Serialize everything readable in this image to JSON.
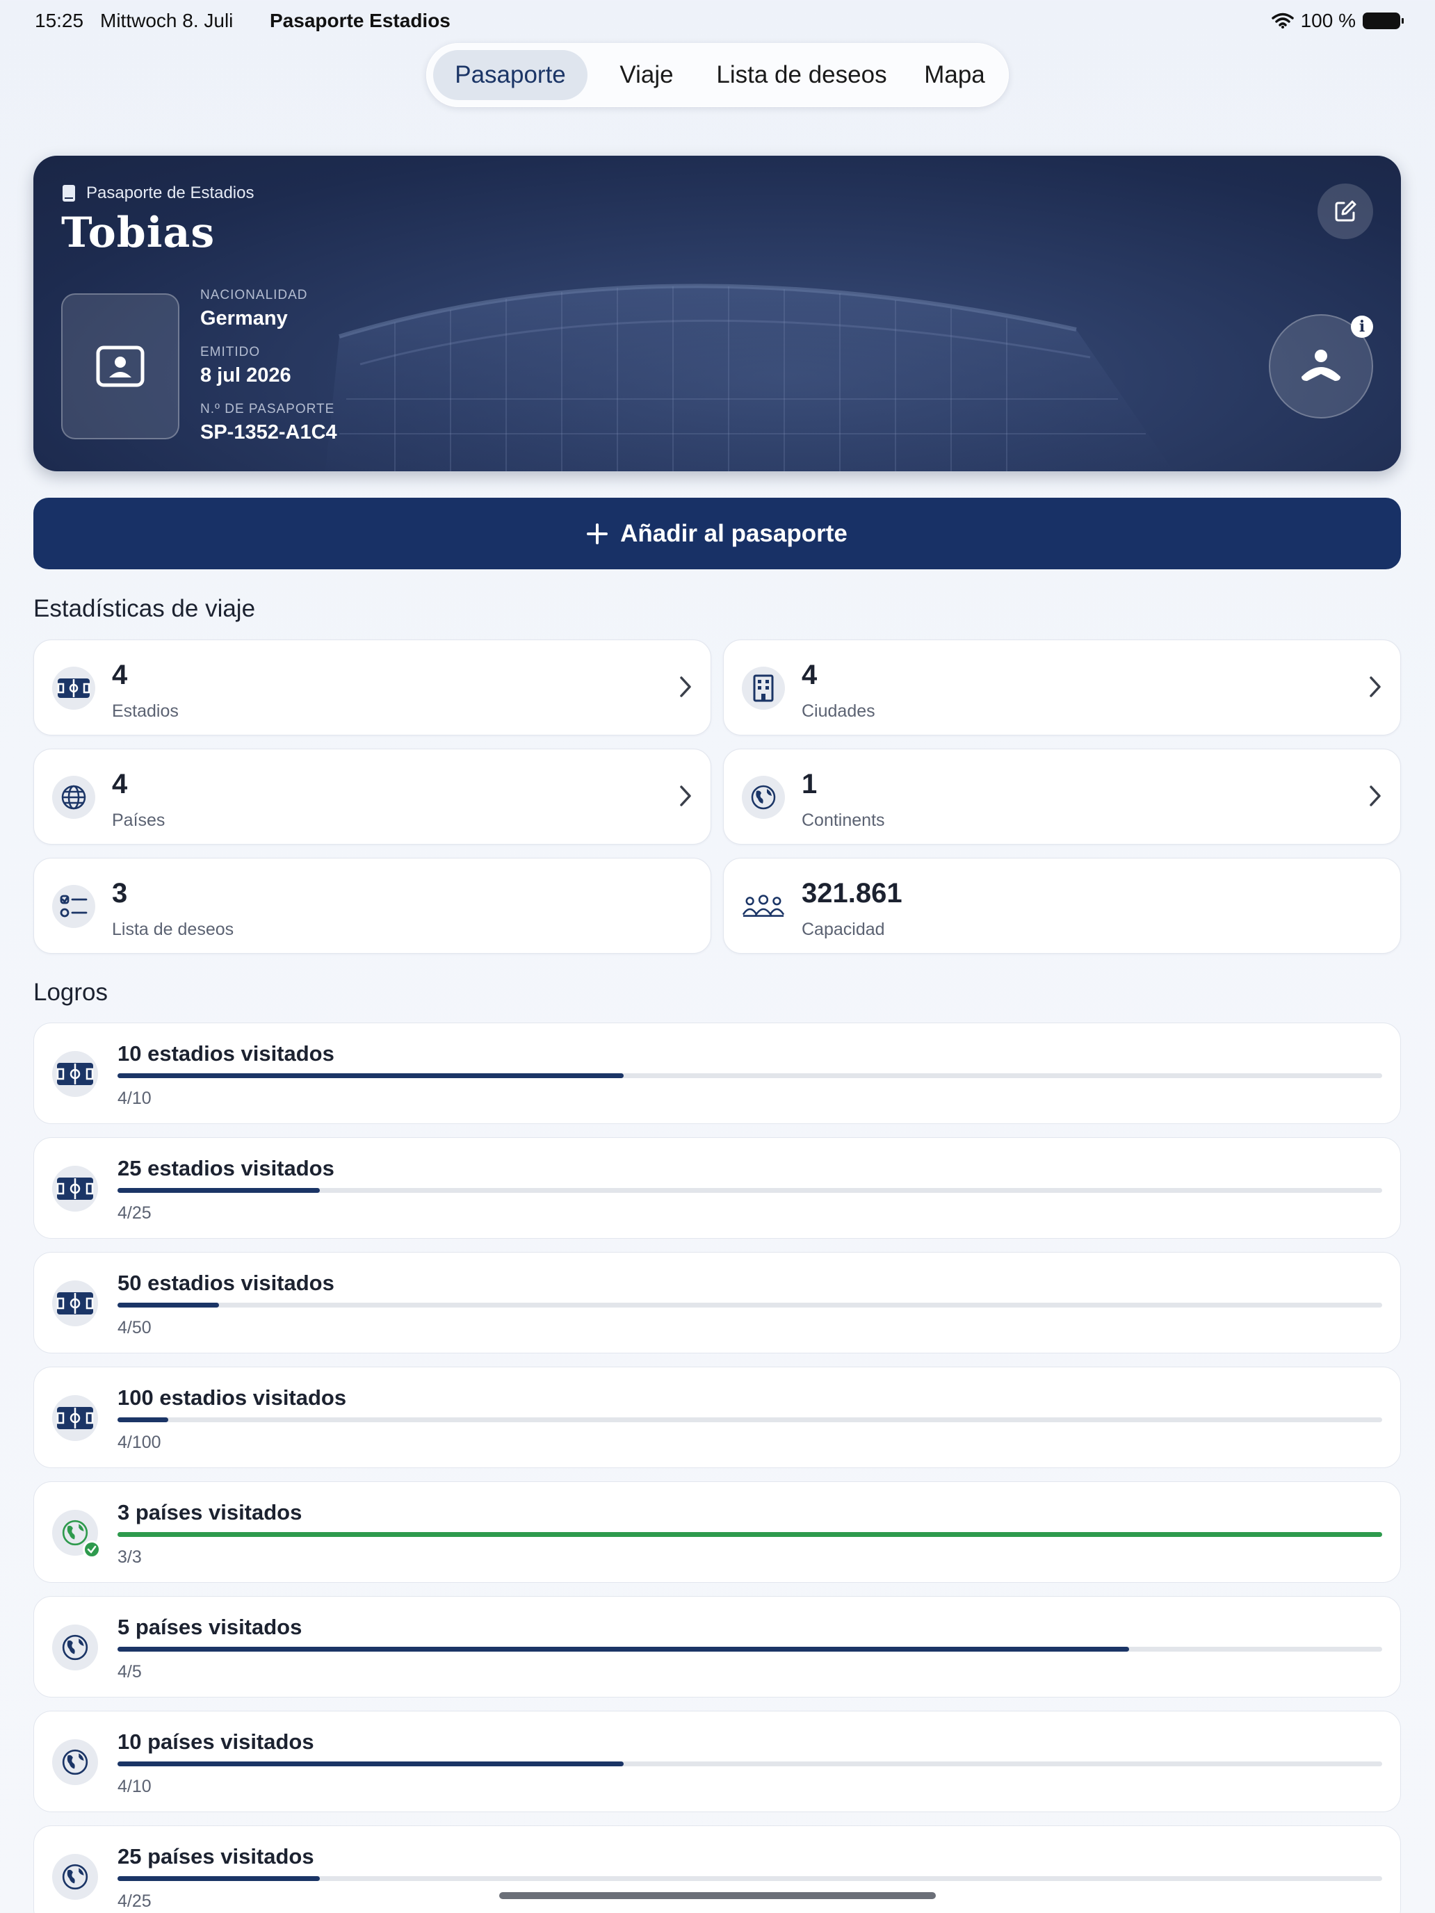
{
  "status_bar": {
    "time": "15:25",
    "date": "Mittwoch 8. Juli",
    "app_name": "Pasaporte Estadios",
    "battery": "100 %"
  },
  "tabs": [
    {
      "label": "Pasaporte",
      "active": true
    },
    {
      "label": "Viaje",
      "active": false
    },
    {
      "label": "Lista de deseos",
      "active": false
    },
    {
      "label": "Mapa",
      "active": false
    }
  ],
  "passport": {
    "label": "Pasaporte de Estadios",
    "name": "Tobias",
    "nationality_label": "NACIONALIDAD",
    "nationality": "Germany",
    "issued_label": "EMITIDO",
    "issued": "8 jul 2026",
    "number_label": "N.º DE PASAPORTE",
    "number": "SP-1352-A1C4",
    "info_icon": "i"
  },
  "add_button": {
    "label": "Añadir al pasaporte"
  },
  "stats": {
    "title": "Estadísticas de viaje",
    "items": [
      {
        "value": "4",
        "label": "Estadios",
        "icon": "stadium-icon",
        "chevron": true
      },
      {
        "value": "4",
        "label": "Ciudades",
        "icon": "building-icon",
        "chevron": true
      },
      {
        "value": "4",
        "label": "Países",
        "icon": "globe-icon",
        "chevron": true
      },
      {
        "value": "1",
        "label": "Continents",
        "icon": "earth-icon",
        "chevron": true
      },
      {
        "value": "3",
        "label": "Lista de deseos",
        "icon": "checklist-icon",
        "chevron": false
      },
      {
        "value": "321.861",
        "label": "Capacidad",
        "icon": "people-icon",
        "chevron": false
      }
    ]
  },
  "achievements": {
    "title": "Logros",
    "items": [
      {
        "title": "10 estadios visitados",
        "progress": "4/10",
        "fraction": 0.4,
        "icon": "stadium-icon",
        "done": false
      },
      {
        "title": "25 estadios visitados",
        "progress": "4/25",
        "fraction": 0.16,
        "icon": "stadium-icon",
        "done": false
      },
      {
        "title": "50 estadios visitados",
        "progress": "4/50",
        "fraction": 0.08,
        "icon": "stadium-icon",
        "done": false
      },
      {
        "title": "100 estadios visitados",
        "progress": "4/100",
        "fraction": 0.04,
        "icon": "stadium-icon",
        "done": false
      },
      {
        "title": "3 países visitados",
        "progress": "3/3",
        "fraction": 1.0,
        "icon": "earth-icon",
        "done": true
      },
      {
        "title": "5 países visitados",
        "progress": "4/5",
        "fraction": 0.8,
        "icon": "earth-icon",
        "done": false
      },
      {
        "title": "10 países visitados",
        "progress": "4/10",
        "fraction": 0.4,
        "icon": "earth-icon",
        "done": false
      },
      {
        "title": "25 países visitados",
        "progress": "4/25",
        "fraction": 0.16,
        "icon": "earth-icon",
        "done": false
      }
    ]
  },
  "colors": {
    "primary": "#183166",
    "success": "#2e9a4d",
    "card_bg": "#1d2b4f"
  }
}
